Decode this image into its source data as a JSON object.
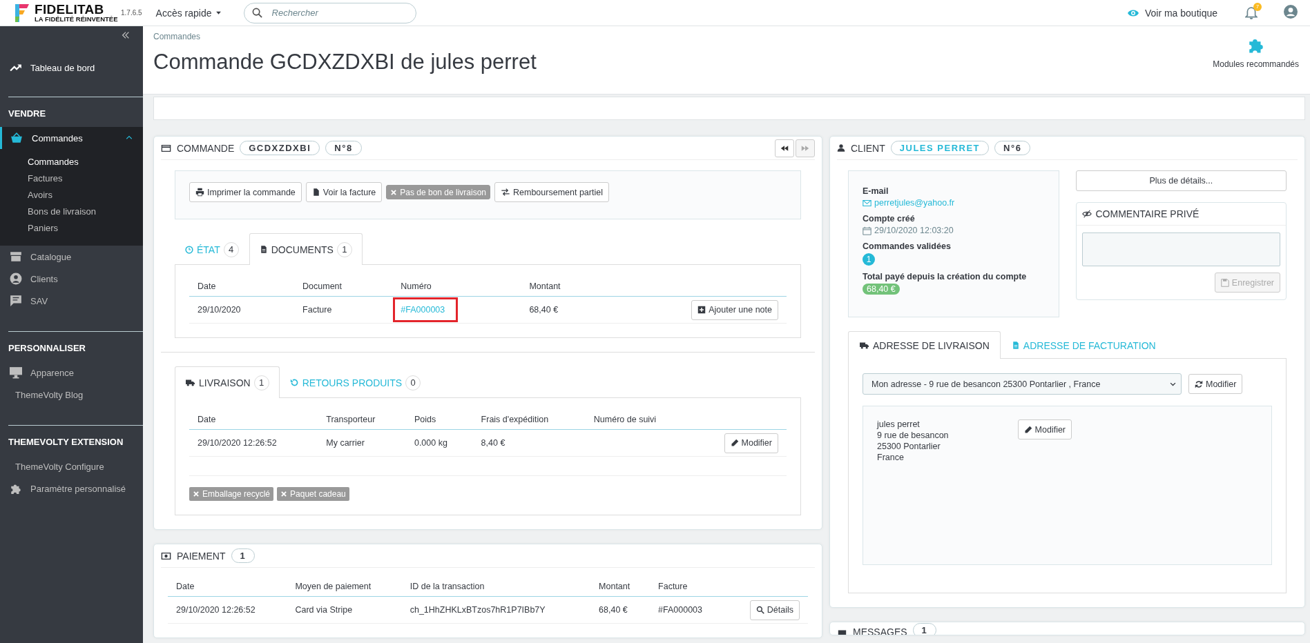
{
  "header": {
    "brand": "FIDELITAB",
    "tagline": "LA FIDÉLITÉ RÉINVENTÉE",
    "version": "1.7.6.5",
    "quick_access": "Accès rapide",
    "search": {
      "placeholder": "Rechercher"
    },
    "shop_link": "Voir ma boutique",
    "notifications_count": "7"
  },
  "sidebar": {
    "top": [
      {
        "label": "Tableau de bord",
        "selected": false
      }
    ],
    "sections": [
      {
        "title": "VENDRE",
        "items": [
          {
            "label": "Commandes",
            "selected": true,
            "expanded": true,
            "children": [
              {
                "label": "Commandes",
                "selected": true
              },
              {
                "label": "Factures",
                "selected": false
              },
              {
                "label": "Avoirs",
                "selected": false
              },
              {
                "label": "Bons de livraison",
                "selected": false
              },
              {
                "label": "Paniers",
                "selected": false
              }
            ]
          },
          {
            "label": "Catalogue",
            "selected": false
          },
          {
            "label": "Clients",
            "selected": false
          },
          {
            "label": "SAV",
            "selected": false
          }
        ]
      },
      {
        "title": "PERSONNALISER",
        "items": [
          {
            "label": "Apparence",
            "selected": false
          },
          {
            "label": "ThemeVolty Blog",
            "selected": false
          }
        ]
      },
      {
        "title": "THEMEVOLTY EXTENSION",
        "items": [
          {
            "label": "ThemeVolty Configure",
            "selected": false
          },
          {
            "label": "Paramètre personnalisé",
            "selected": false
          }
        ]
      }
    ]
  },
  "page": {
    "breadcrumb": "Commandes",
    "title": "Commande GCDXZDXBI de jules perret",
    "toolbar_button": "Modules recommandés"
  },
  "order": {
    "title": "COMMANDE",
    "reference": "GCDXZDXBI",
    "number": "N°8",
    "actions": [
      {
        "label": "Imprimer la commande",
        "disabled": false
      },
      {
        "label": "Voir la facture",
        "disabled": false
      },
      {
        "label": "Pas de bon de livraison",
        "disabled": true
      },
      {
        "label": "Remboursement partiel",
        "disabled": false
      }
    ],
    "tabs": [
      {
        "label": "ÉTAT",
        "count": "4",
        "selected": false
      },
      {
        "label": "DOCUMENTS",
        "count": "1",
        "selected": true
      }
    ],
    "documents": {
      "columns": [
        "Date",
        "Document",
        "Numéro",
        "Montant"
      ],
      "rows": [
        {
          "date": "29/10/2020",
          "document": "Facture",
          "number": "#FA000003",
          "highlighted": true,
          "amount": "68,40 €",
          "action": "Ajouter une note"
        }
      ]
    },
    "shipping_tabs": [
      {
        "label": "LIVRAISON",
        "count": "1",
        "selected": true
      },
      {
        "label": "RETOURS PRODUITS",
        "count": "0",
        "selected": false
      }
    ],
    "shipping": {
      "columns": [
        "Date",
        "Transporteur",
        "Poids",
        "Frais d'expédition",
        "Numéro de suivi"
      ],
      "rows": [
        {
          "cells": [
            "29/10/2020 12:26:52",
            "My carrier",
            "0.000 kg",
            "8,40 €",
            ""
          ],
          "action": "Modifier"
        }
      ]
    },
    "options": [
      {
        "label": "Emballage recyclé",
        "checked": false
      },
      {
        "label": "Paquet cadeau",
        "checked": false
      }
    ]
  },
  "payment": {
    "title": "PAIEMENT",
    "count": "1",
    "columns": [
      "Date",
      "Moyen de paiement",
      "ID de la transaction",
      "Montant",
      "Facture"
    ],
    "rows": [
      {
        "cells": [
          "29/10/2020 12:26:52",
          "Card via Stripe",
          "ch_1HhZHKLxBTzos7hR1P7IBb7Y",
          "68,40 €",
          "#FA000003"
        ],
        "action": "Détails"
      }
    ]
  },
  "customer": {
    "title": "CLIENT",
    "name": "JULES PERRET",
    "number": "N°6",
    "email_label": "E-mail",
    "email": "perretjules@yahoo.fr",
    "created_label": "Compte créé",
    "created": "29/10/2020 12:03:20",
    "orders_label": "Commandes validées",
    "orders_count": "1",
    "total_label": "Total payé depuis la création du compte",
    "total": "68,40 €",
    "details_button": "Plus de détails...",
    "comment_title": "COMMENTAIRE PRIVÉ",
    "save_button": "Enregistrer",
    "save_disabled": true
  },
  "address": {
    "tabs": [
      {
        "label": "ADRESSE DE LIVRAISON",
        "selected": true
      },
      {
        "label": "ADRESSE DE FACTURATION",
        "selected": false
      }
    ],
    "select_value": "Mon adresse - 9 rue de besancon 25300 Pontarlier , France",
    "change_button": "Modifier",
    "lines": [
      "jules perret",
      "9 rue de besancon",
      "25300 Pontarlier",
      "France"
    ],
    "edit_button": "Modifier"
  },
  "messages": {
    "title": "MESSAGES",
    "count": "1"
  }
}
